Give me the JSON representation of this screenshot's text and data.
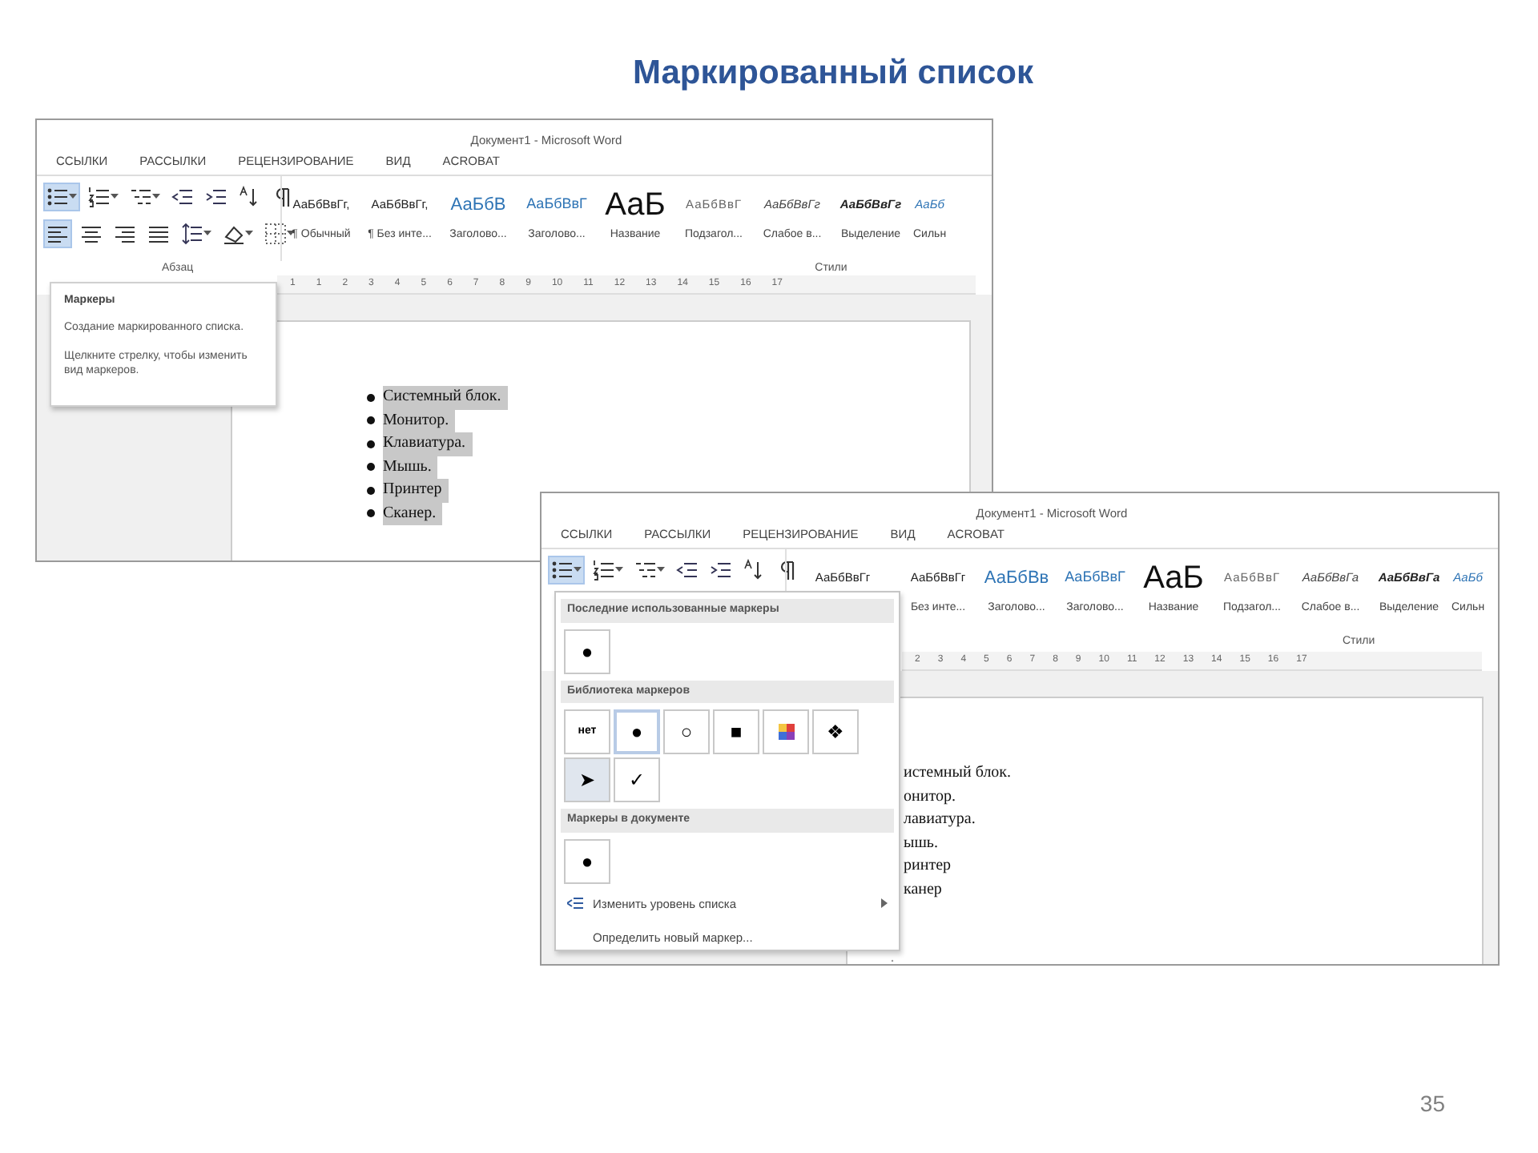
{
  "slide": {
    "title": "Маркированный список",
    "page_number": "35"
  },
  "windows": [
    {
      "title": "Документ1 - Microsoft Word",
      "ribbon_tabs": [
        "ССЫЛКИ",
        "РАССЫЛКИ",
        "РЕЦЕНЗИРОВАНИЕ",
        "ВИД",
        "ACROBAT"
      ],
      "ribbon_rows": [
        [
          {
            "kind": "bullets",
            "pressed": true
          },
          {
            "kind": "numbering",
            "pressed": false
          },
          {
            "kind": "multilevel",
            "pressed": false
          },
          {
            "kind": "outdent",
            "pressed": false
          },
          {
            "kind": "indent",
            "pressed": false
          },
          {
            "kind": "sort",
            "pressed": false
          },
          {
            "kind": "pilcrow",
            "pressed": false
          }
        ],
        [
          {
            "kind": "align-left",
            "pressed": true
          },
          {
            "kind": "align-center",
            "pressed": false
          },
          {
            "kind": "align-right",
            "pressed": false
          },
          {
            "kind": "justify",
            "pressed": false
          },
          {
            "kind": "spacing",
            "pressed": false
          },
          {
            "kind": "shading",
            "pressed": false
          },
          {
            "kind": "borders",
            "pressed": false
          }
        ]
      ],
      "styles": [
        {
          "kind": "plain",
          "sample": "АаБбВвГг,",
          "name": "¶ Обычный"
        },
        {
          "kind": "plain",
          "sample": "АаБбВвГг,",
          "name": "¶ Без инте..."
        },
        {
          "kind": "heading",
          "sample": "АаБбВ",
          "name": "Заголово..."
        },
        {
          "kind": "heading2",
          "sample": "АаБбВвГ",
          "name": "Заголово..."
        },
        {
          "kind": "title",
          "sample": "АаБ",
          "name": "Название"
        },
        {
          "kind": "subtitle",
          "sample": "АаБбВвГ",
          "name": "Подзагол..."
        },
        {
          "kind": "italic",
          "sample": "АаБбВвГг",
          "name": "Слабое в..."
        },
        {
          "kind": "bold-italic",
          "sample": "АаБбВвГг",
          "name": "Выделение"
        },
        {
          "kind": "accent",
          "sample": "АаБб",
          "name": "Сильн"
        }
      ],
      "group_labels": [
        "Абзац",
        "Стили"
      ],
      "ruler": [
        "1",
        "1",
        "2",
        "3",
        "4",
        "5",
        "6",
        "7",
        "8",
        "9",
        "10",
        "11",
        "12",
        "13",
        "14",
        "15",
        "16",
        "17"
      ],
      "bullets_shown": true,
      "list": [
        "Системный блок.",
        "Монитор.",
        "Клавиатура.",
        "Мышь.",
        "Принтер",
        "Сканер."
      ],
      "tooltip": {
        "title": "Маркеры",
        "lines": [
          "Создание маркированного списка.",
          "Щелкните стрелку, чтобы изменить вид маркеров."
        ]
      }
    },
    {
      "title": "Документ1 - Microsoft Word",
      "ribbon_tabs": [
        "ССЫЛКИ",
        "РАССЫЛКИ",
        "РЕЦЕНЗИРОВАНИЕ",
        "ВИД",
        "ACROBAT"
      ],
      "ribbon_rows": [
        [
          {
            "kind": "bullets",
            "pressed": true
          },
          {
            "kind": "numbering",
            "pressed": false
          },
          {
            "kind": "multilevel",
            "pressed": false
          },
          {
            "kind": "outdent",
            "pressed": false
          },
          {
            "kind": "indent",
            "pressed": false
          },
          {
            "kind": "sort",
            "pressed": false
          },
          {
            "kind": "pilcrow",
            "pressed": false
          }
        ]
      ],
      "styles": [
        {
          "kind": "plain",
          "sample": "АаБбВвГг"
        },
        {
          "kind": "plain",
          "sample": "АаБбВвГг",
          "name": "Без инте..."
        },
        {
          "kind": "heading",
          "sample": "АаБбВв",
          "name": "Заголово..."
        },
        {
          "kind": "heading2",
          "sample": "АаБбВвГ",
          "name": "Заголово..."
        },
        {
          "kind": "title",
          "sample": "АаБ",
          "name": "Название"
        },
        {
          "kind": "subtitle",
          "sample": "АаБбВвГ",
          "name": "Подзагол..."
        },
        {
          "kind": "italic",
          "sample": "АаБбВвГа",
          "name": "Слабое в..."
        },
        {
          "kind": "bold-italic",
          "sample": "АаБбВвГа",
          "name": "Выделение"
        },
        {
          "kind": "accent",
          "sample": "АаБб",
          "name": "Сильн"
        }
      ],
      "group_labels": [
        "Стили"
      ],
      "ruler": [
        "2",
        "3",
        "4",
        "5",
        "6",
        "7",
        "8",
        "9",
        "10",
        "11",
        "12",
        "13",
        "14",
        "15",
        "16",
        "17"
      ],
      "bullets_shown": false,
      "list": [
        "истемный блок.",
        "онитор.",
        "лавиатура.",
        "ышь.",
        "ринтер",
        "канер"
      ],
      "menu": {
        "sections": [
          {
            "title": "Последние использованные маркеры",
            "items": [
              {
                "kind": "glyph",
                "glyph": "●",
                "selected": false
              }
            ]
          },
          {
            "title": "Библиотека маркеров",
            "items": [
              {
                "kind": "text",
                "glyph": "нет",
                "selected": false
              },
              {
                "kind": "glyph",
                "glyph": "●",
                "selected": true
              },
              {
                "kind": "glyph",
                "glyph": "○",
                "selected": false
              },
              {
                "kind": "glyph",
                "glyph": "■",
                "selected": false
              },
              {
                "kind": "picture",
                "selected": false
              },
              {
                "kind": "glyph",
                "glyph": "❖",
                "selected": false
              },
              {
                "kind": "glyph",
                "glyph": "➤",
                "selected": false,
                "hovered": true
              },
              {
                "kind": "glyph",
                "glyph": "✓",
                "selected": false
              }
            ]
          },
          {
            "title": "Маркеры в документе",
            "items": [
              {
                "kind": "glyph",
                "glyph": "●",
                "selected": false
              }
            ]
          }
        ],
        "commands": [
          {
            "label": "Изменить уровень списка",
            "has_icon": true,
            "submenu": true
          },
          {
            "label": "Определить новый маркер...",
            "has_icon": false,
            "submenu": false
          }
        ]
      }
    }
  ]
}
